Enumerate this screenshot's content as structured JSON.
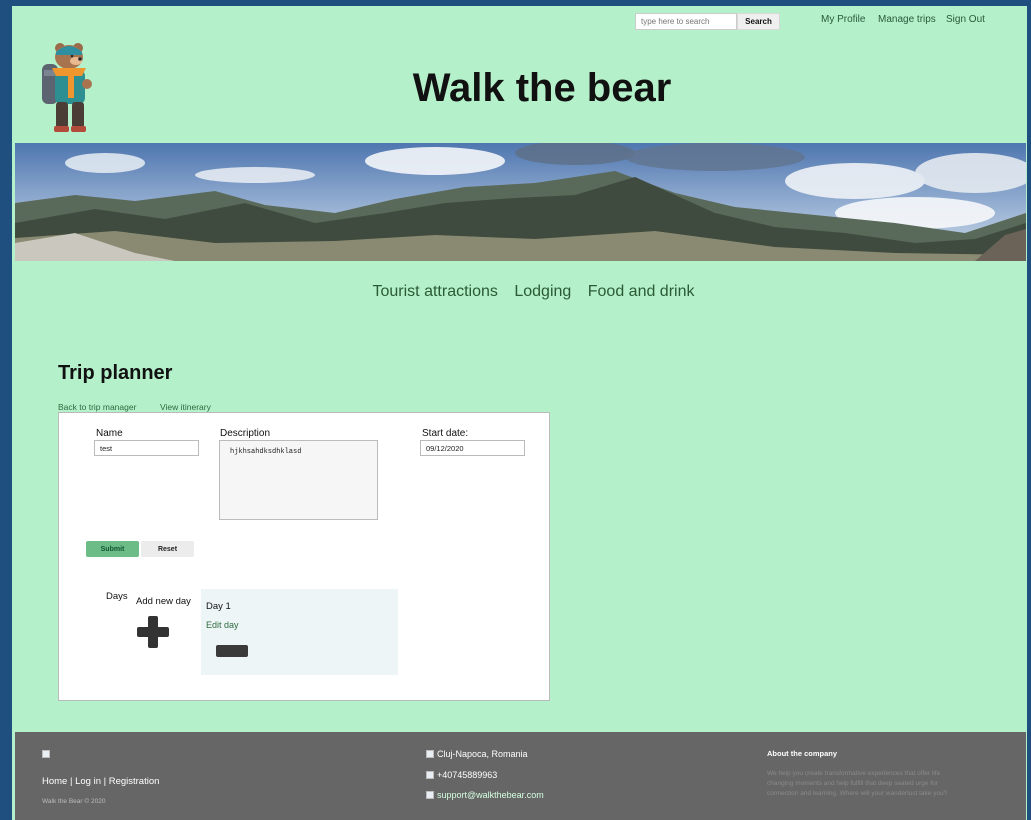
{
  "header": {
    "search_placeholder": "type here to search",
    "search_button": "Search",
    "links": [
      "My Profile",
      "Manage trips",
      "Sign Out"
    ],
    "site_title": "Walk the bear"
  },
  "nav": {
    "items": [
      "Tourist attractions",
      "Lodging",
      "Food and drink"
    ]
  },
  "planner": {
    "title": "Trip planner",
    "back_link": "Back to trip manager",
    "view_link": "View itinerary",
    "name_label": "Name",
    "name_value": "test",
    "description_label": "Description",
    "description_value": "hjkhsahdksdhklasd",
    "start_date_label": "Start date:",
    "start_date_value": "09/12/2020",
    "submit_label": "Submit",
    "reset_label": "Reset",
    "days_label": "Days",
    "add_day_label": "Add new day",
    "day_title": "Day 1",
    "edit_day_label": "Edit day"
  },
  "footer": {
    "links_line": "Home | Log in | Registration",
    "copyright": "Walk the Bear © 2020",
    "location": "Cluj-Napoca, Romania",
    "phone": "+40745889963",
    "email": "support@walkthebear.com",
    "about_title": "About the company",
    "about_text": "We help you create transformative experiences that offer life changing moments and help fulfill that deep seated urge for connection and learning. Where will your wanderlust take you?"
  },
  "colors": {
    "page_bg": "#b4f0ca",
    "outer_bg": "#1f4f7f",
    "footer_bg": "#666666",
    "submit_bg": "#6cbc88"
  }
}
